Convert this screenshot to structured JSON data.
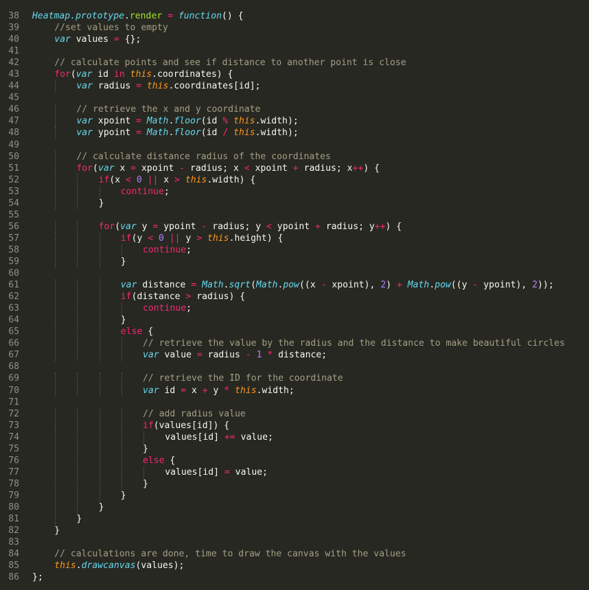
{
  "editor": {
    "theme": {
      "background": "#272822",
      "gutter": "#90908a",
      "plain": "#f8f8f2",
      "comment": "#a59f85",
      "keyword": "#f92672",
      "storage": "#66d9ef",
      "this": "#fd971f",
      "function": "#a6e22e",
      "number": "#ae81ff"
    },
    "lines": [
      {
        "n": "38",
        "indent": 0,
        "tokens": [
          [
            "support",
            "Heatmap.prototype"
          ],
          [
            "plain",
            "."
          ],
          [
            "func",
            "render"
          ],
          [
            "plain",
            " "
          ],
          [
            "op",
            "="
          ],
          [
            "plain",
            " "
          ],
          [
            "storage",
            "function"
          ],
          [
            "plain",
            "() {"
          ]
        ]
      },
      {
        "n": "39",
        "indent": 1,
        "tokens": [
          [
            "comment",
            "//set values to empty"
          ]
        ]
      },
      {
        "n": "40",
        "indent": 1,
        "tokens": [
          [
            "storage",
            "var"
          ],
          [
            "plain",
            " values "
          ],
          [
            "op",
            "="
          ],
          [
            "plain",
            " {};"
          ]
        ]
      },
      {
        "n": "41",
        "indent": 0,
        "tokens": []
      },
      {
        "n": "42",
        "indent": 1,
        "tokens": [
          [
            "comment",
            "// calculate points and see if distance to another point is close"
          ]
        ]
      },
      {
        "n": "43",
        "indent": 1,
        "tokens": [
          [
            "keyword",
            "for"
          ],
          [
            "plain",
            "("
          ],
          [
            "storage",
            "var"
          ],
          [
            "plain",
            " id "
          ],
          [
            "keyword",
            "in"
          ],
          [
            "plain",
            " "
          ],
          [
            "this",
            "this"
          ],
          [
            "plain",
            ".coordinates) {"
          ]
        ]
      },
      {
        "n": "44",
        "indent": 2,
        "tokens": [
          [
            "storage",
            "var"
          ],
          [
            "plain",
            " radius "
          ],
          [
            "op",
            "="
          ],
          [
            "plain",
            " "
          ],
          [
            "this",
            "this"
          ],
          [
            "plain",
            ".coordinates[id];"
          ]
        ]
      },
      {
        "n": "45",
        "indent": 0,
        "tokens": []
      },
      {
        "n": "46",
        "indent": 2,
        "tokens": [
          [
            "comment",
            "// retrieve the x and y coordinate"
          ]
        ]
      },
      {
        "n": "47",
        "indent": 2,
        "tokens": [
          [
            "storage",
            "var"
          ],
          [
            "plain",
            " xpoint "
          ],
          [
            "op",
            "="
          ],
          [
            "plain",
            " "
          ],
          [
            "support",
            "Math"
          ],
          [
            "plain",
            "."
          ],
          [
            "support",
            "floor"
          ],
          [
            "plain",
            "(id "
          ],
          [
            "op",
            "%"
          ],
          [
            "plain",
            " "
          ],
          [
            "this",
            "this"
          ],
          [
            "plain",
            ".width);"
          ]
        ]
      },
      {
        "n": "48",
        "indent": 2,
        "tokens": [
          [
            "storage",
            "var"
          ],
          [
            "plain",
            " ypoint "
          ],
          [
            "op",
            "="
          ],
          [
            "plain",
            " "
          ],
          [
            "support",
            "Math"
          ],
          [
            "plain",
            "."
          ],
          [
            "support",
            "floor"
          ],
          [
            "plain",
            "(id "
          ],
          [
            "op",
            "/"
          ],
          [
            "plain",
            " "
          ],
          [
            "this",
            "this"
          ],
          [
            "plain",
            ".width);"
          ]
        ]
      },
      {
        "n": "49",
        "indent": 0,
        "tokens": []
      },
      {
        "n": "50",
        "indent": 2,
        "tokens": [
          [
            "comment",
            "// calculate distance radius of the coordinates"
          ]
        ]
      },
      {
        "n": "51",
        "indent": 2,
        "tokens": [
          [
            "keyword",
            "for"
          ],
          [
            "plain",
            "("
          ],
          [
            "storage",
            "var"
          ],
          [
            "plain",
            " x "
          ],
          [
            "op",
            "="
          ],
          [
            "plain",
            " xpoint "
          ],
          [
            "op",
            "-"
          ],
          [
            "plain",
            " radius; x "
          ],
          [
            "op",
            "<"
          ],
          [
            "plain",
            " xpoint "
          ],
          [
            "op",
            "+"
          ],
          [
            "plain",
            " radius; x"
          ],
          [
            "op",
            "++"
          ],
          [
            "plain",
            ") {"
          ]
        ]
      },
      {
        "n": "52",
        "indent": 3,
        "tokens": [
          [
            "keyword",
            "if"
          ],
          [
            "plain",
            "(x "
          ],
          [
            "op",
            "<"
          ],
          [
            "plain",
            " "
          ],
          [
            "number",
            "0"
          ],
          [
            "plain",
            " "
          ],
          [
            "op",
            "||"
          ],
          [
            "plain",
            " x "
          ],
          [
            "op",
            ">"
          ],
          [
            "plain",
            " "
          ],
          [
            "this",
            "this"
          ],
          [
            "plain",
            ".width) {"
          ]
        ]
      },
      {
        "n": "53",
        "indent": 4,
        "tokens": [
          [
            "keyword",
            "continue"
          ],
          [
            "plain",
            ";"
          ]
        ]
      },
      {
        "n": "54",
        "indent": 3,
        "tokens": [
          [
            "plain",
            "}"
          ]
        ]
      },
      {
        "n": "55",
        "indent": 0,
        "tokens": []
      },
      {
        "n": "56",
        "indent": 3,
        "tokens": [
          [
            "keyword",
            "for"
          ],
          [
            "plain",
            "("
          ],
          [
            "storage",
            "var"
          ],
          [
            "plain",
            " y "
          ],
          [
            "op",
            "="
          ],
          [
            "plain",
            " ypoint "
          ],
          [
            "op",
            "-"
          ],
          [
            "plain",
            " radius; y "
          ],
          [
            "op",
            "<"
          ],
          [
            "plain",
            " ypoint "
          ],
          [
            "op",
            "+"
          ],
          [
            "plain",
            " radius; y"
          ],
          [
            "op",
            "++"
          ],
          [
            "plain",
            ") {"
          ]
        ]
      },
      {
        "n": "57",
        "indent": 4,
        "tokens": [
          [
            "keyword",
            "if"
          ],
          [
            "plain",
            "(y "
          ],
          [
            "op",
            "<"
          ],
          [
            "plain",
            " "
          ],
          [
            "number",
            "0"
          ],
          [
            "plain",
            " "
          ],
          [
            "op",
            "||"
          ],
          [
            "plain",
            " y "
          ],
          [
            "op",
            ">"
          ],
          [
            "plain",
            " "
          ],
          [
            "this",
            "this"
          ],
          [
            "plain",
            ".height) {"
          ]
        ]
      },
      {
        "n": "58",
        "indent": 5,
        "tokens": [
          [
            "keyword",
            "continue"
          ],
          [
            "plain",
            ";"
          ]
        ]
      },
      {
        "n": "59",
        "indent": 4,
        "tokens": [
          [
            "plain",
            "}"
          ]
        ]
      },
      {
        "n": "60",
        "indent": 0,
        "tokens": []
      },
      {
        "n": "61",
        "indent": 4,
        "tokens": [
          [
            "storage",
            "var"
          ],
          [
            "plain",
            " distance "
          ],
          [
            "op",
            "="
          ],
          [
            "plain",
            " "
          ],
          [
            "support",
            "Math"
          ],
          [
            "plain",
            "."
          ],
          [
            "support",
            "sqrt"
          ],
          [
            "plain",
            "("
          ],
          [
            "support",
            "Math"
          ],
          [
            "plain",
            "."
          ],
          [
            "support",
            "pow"
          ],
          [
            "plain",
            "((x "
          ],
          [
            "op",
            "-"
          ],
          [
            "plain",
            " xpoint), "
          ],
          [
            "number",
            "2"
          ],
          [
            "plain",
            ") "
          ],
          [
            "op",
            "+"
          ],
          [
            "plain",
            " "
          ],
          [
            "support",
            "Math"
          ],
          [
            "plain",
            "."
          ],
          [
            "support",
            "pow"
          ],
          [
            "plain",
            "((y "
          ],
          [
            "op",
            "-"
          ],
          [
            "plain",
            " ypoint), "
          ],
          [
            "number",
            "2"
          ],
          [
            "plain",
            "));"
          ]
        ]
      },
      {
        "n": "62",
        "indent": 4,
        "tokens": [
          [
            "keyword",
            "if"
          ],
          [
            "plain",
            "(distance "
          ],
          [
            "op",
            ">"
          ],
          [
            "plain",
            " radius) {"
          ]
        ]
      },
      {
        "n": "63",
        "indent": 5,
        "tokens": [
          [
            "keyword",
            "continue"
          ],
          [
            "plain",
            ";"
          ]
        ]
      },
      {
        "n": "64",
        "indent": 4,
        "tokens": [
          [
            "plain",
            "}"
          ]
        ]
      },
      {
        "n": "65",
        "indent": 4,
        "tokens": [
          [
            "keyword",
            "else"
          ],
          [
            "plain",
            " {"
          ]
        ]
      },
      {
        "n": "66",
        "indent": 5,
        "tokens": [
          [
            "comment",
            "// retrieve the value by the radius and the distance to make beautiful circles"
          ]
        ]
      },
      {
        "n": "67",
        "indent": 5,
        "tokens": [
          [
            "storage",
            "var"
          ],
          [
            "plain",
            " value "
          ],
          [
            "op",
            "="
          ],
          [
            "plain",
            " radius "
          ],
          [
            "op",
            "-"
          ],
          [
            "plain",
            " "
          ],
          [
            "number",
            "1"
          ],
          [
            "plain",
            " "
          ],
          [
            "op",
            "*"
          ],
          [
            "plain",
            " distance;"
          ]
        ]
      },
      {
        "n": "68",
        "indent": 0,
        "tokens": []
      },
      {
        "n": "69",
        "indent": 5,
        "tokens": [
          [
            "comment",
            "// retrieve the ID for the coordinate"
          ]
        ]
      },
      {
        "n": "70",
        "indent": 5,
        "tokens": [
          [
            "storage",
            "var"
          ],
          [
            "plain",
            " id "
          ],
          [
            "op",
            "="
          ],
          [
            "plain",
            " x "
          ],
          [
            "op",
            "+"
          ],
          [
            "plain",
            " y "
          ],
          [
            "op",
            "*"
          ],
          [
            "plain",
            " "
          ],
          [
            "this",
            "this"
          ],
          [
            "plain",
            ".width;"
          ]
        ]
      },
      {
        "n": "71",
        "indent": 0,
        "tokens": []
      },
      {
        "n": "72",
        "indent": 5,
        "tokens": [
          [
            "comment",
            "// add radius value"
          ]
        ]
      },
      {
        "n": "73",
        "indent": 5,
        "tokens": [
          [
            "keyword",
            "if"
          ],
          [
            "plain",
            "(values[id]) {"
          ]
        ]
      },
      {
        "n": "74",
        "indent": 6,
        "tokens": [
          [
            "plain",
            "values[id] "
          ],
          [
            "op",
            "+="
          ],
          [
            "plain",
            " value;"
          ]
        ]
      },
      {
        "n": "75",
        "indent": 5,
        "tokens": [
          [
            "plain",
            "}"
          ]
        ]
      },
      {
        "n": "76",
        "indent": 5,
        "tokens": [
          [
            "keyword",
            "else"
          ],
          [
            "plain",
            " {"
          ]
        ]
      },
      {
        "n": "77",
        "indent": 6,
        "tokens": [
          [
            "plain",
            "values[id] "
          ],
          [
            "op",
            "="
          ],
          [
            "plain",
            " value;"
          ]
        ]
      },
      {
        "n": "78",
        "indent": 5,
        "tokens": [
          [
            "plain",
            "}"
          ]
        ]
      },
      {
        "n": "79",
        "indent": 4,
        "tokens": [
          [
            "plain",
            "}"
          ]
        ]
      },
      {
        "n": "80",
        "indent": 3,
        "tokens": [
          [
            "plain",
            "}"
          ]
        ]
      },
      {
        "n": "81",
        "indent": 2,
        "tokens": [
          [
            "plain",
            "}"
          ]
        ]
      },
      {
        "n": "82",
        "indent": 1,
        "tokens": [
          [
            "plain",
            "}"
          ]
        ]
      },
      {
        "n": "83",
        "indent": 0,
        "tokens": []
      },
      {
        "n": "84",
        "indent": 1,
        "tokens": [
          [
            "comment",
            "// calculations are done, time to draw the canvas with the values"
          ]
        ]
      },
      {
        "n": "85",
        "indent": 1,
        "tokens": [
          [
            "this",
            "this"
          ],
          [
            "plain",
            "."
          ],
          [
            "support",
            "drawcanvas"
          ],
          [
            "plain",
            "(values);"
          ]
        ]
      },
      {
        "n": "86",
        "indent": 0,
        "tokens": [
          [
            "plain",
            "};"
          ]
        ]
      }
    ]
  }
}
